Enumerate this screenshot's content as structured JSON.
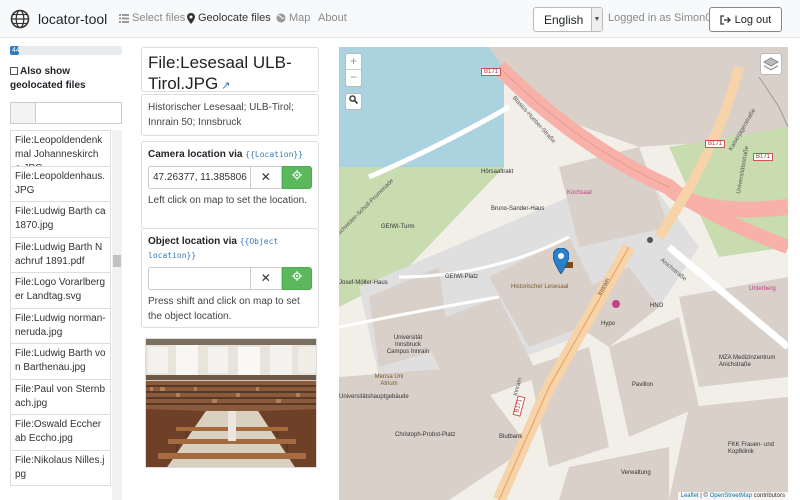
{
  "navbar": {
    "brand": "locator-tool",
    "select_files": "Select files",
    "geolocate_files": "Geolocate files",
    "map": "Map",
    "about": "About",
    "language": "English",
    "logged_in": "Logged in as Simon04",
    "logout": "Log out"
  },
  "sidebar": {
    "progress_label": "44 /",
    "progress_value": 0.08,
    "also_show": "Also show geolocated files",
    "search_value": "",
    "files": [
      "File:Leopoldendenkmal Johanneskirche.JPG",
      "File:Leopoldenhaus.JPG",
      "File:Ludwig Barth ca1870.jpg",
      "File:Ludwig Barth Nachruf 1891.pdf",
      "File:Logo Vorarlberger Landtag.svg",
      "File:Ludwig norman-neruda.jpg",
      "File:Ludwig Barth von Barthenau.jpg",
      "File:Paul von Sternbach.jpg",
      "File:Oswald Eccher ab Eccho.jpg",
      "File:Nikolaus Nilles.jpg"
    ]
  },
  "file": {
    "title": "File:Lesesaal ULB-Tirol.JPG",
    "description": "Historischer Lesesaal; ULB-Tirol; Innrain 50; Innsbruck"
  },
  "camera": {
    "heading": "Camera location via",
    "template": "{{Location}}",
    "value": "47.26377, 11.385806",
    "help": "Left click on map to set the location."
  },
  "object": {
    "heading": "Object location via",
    "template": "{{Object location}}",
    "value": "",
    "help": "Press shift and click on map to set the object location."
  },
  "map": {
    "attribution_leaflet": "Leaflet",
    "attribution_sep": " | © ",
    "attribution_osm": "OpenStreetMap",
    "attribution_tail": " contributors",
    "labels": {
      "hoersaaltrakt": "Hörsaaltrakt",
      "bruno": "Bruno-Sander-Haus",
      "geiwi_turm": "GEIWI-Turm",
      "geiwi_platz": "GEIWI-Platz",
      "josef": "Josef-Möller-Haus",
      "hist": "Historischer Lesesaal",
      "uni": "Universität Innsbruck Campus Innrain",
      "mensa": "Mensa Uni Atrium",
      "hauptgebaeude": "Universitätshauptgebäude",
      "probst": "Christoph-Probst-Platz",
      "blutbank": "Blutbank",
      "mza": "MZA Medizinzentrum Anichstraße",
      "hno": "HNO",
      "pavillon": "Pavillon",
      "verwaltung": "Verwaltung",
      "fkk": "FKK Frauen- und Kopfklinik",
      "innrain1": "Innrain",
      "innrain2": "Innrain",
      "blasius": "Blasius-Hueber-Straße",
      "anich": "Anichstraße",
      "kaiserjaeger": "Kaiserjägerstraße",
      "universitaetsstr": "Universitätsstraße",
      "unterberg": "Unterberg",
      "b171a": "B171",
      "b171b": "B171",
      "b171c": "B171",
      "b171d": "B171",
      "kochsaal": "Kochsaal",
      "hypo": "Hypo",
      "hno_small": "HNO",
      "promenade": "Geschwister-Scholl-Promenade"
    }
  }
}
